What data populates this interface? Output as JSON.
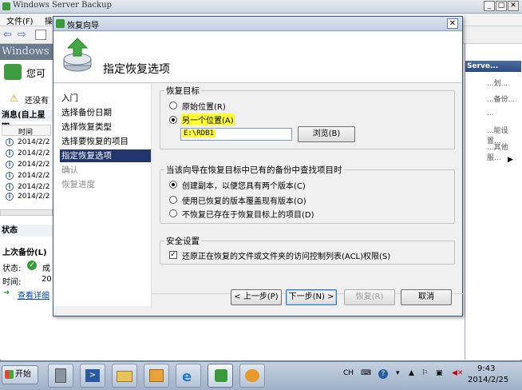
{
  "background_app": {
    "title": "Windows Server Backup",
    "menu": [
      "文件(F)",
      "操"
    ],
    "banner_text": "Windows",
    "banner_subtitle": "您可",
    "warning_text": "还没有",
    "messages_header": "消息(自上星期",
    "column_time": "时间",
    "message_rows": [
      "2014/2/2",
      "2014/2/2",
      "2014/2/2",
      "2014/2/2",
      "2014/2/2",
      "2014/2/2"
    ],
    "status_header": "状态",
    "last_backup_label": "上次备份(L)",
    "status_label": "状态:",
    "status_value": "成",
    "time_label": "时间:",
    "time_value": "20",
    "details_link": "查看详细",
    "right_pane_header": "Serve...",
    "right_pane_items": [
      "...划...",
      "...备份...",
      "...",
      "...能设置...",
      "...其他服..."
    ]
  },
  "wizard": {
    "title": "恢复向导",
    "close_label": "✕",
    "header_title": "指定恢复选项",
    "nav_items": [
      {
        "label": "入门",
        "state": "done"
      },
      {
        "label": "选择备份日期",
        "state": "done"
      },
      {
        "label": "选择恢复类型",
        "state": "done"
      },
      {
        "label": "选择要恢复的项目",
        "state": "done"
      },
      {
        "label": "指定恢复选项",
        "state": "active"
      },
      {
        "label": "确认",
        "state": "pending"
      },
      {
        "label": "恢复进度",
        "state": "pending"
      }
    ],
    "recovery_target": {
      "group_label": "恢复目标",
      "original_location": "原始位置(R)",
      "another_location": "另一个位置(A)",
      "path_value": "E:\\RDB1",
      "browse_button": "浏览(B)",
      "selected": "another_location"
    },
    "existing_items": {
      "group_label": "当该向导在恢复目标中已有的备份中查找项目时",
      "options": [
        {
          "label": "创建副本，以便您具有两个版本(C)",
          "selected": true
        },
        {
          "label": "使用已恢复的版本覆盖现有版本(O)",
          "selected": false
        },
        {
          "label": "不恢复已存在于恢复目标上的项目(D)",
          "selected": false
        }
      ]
    },
    "security": {
      "group_label": "安全设置",
      "acl_checkbox_label": "还原正在恢复的文件或文件夹的访问控制列表(ACL)权限(S)",
      "checked": true
    },
    "buttons": {
      "previous": "< 上一步(P)",
      "next": "下一步(N) >",
      "recover": "恢复(R)",
      "cancel": "取消"
    }
  },
  "taskbar": {
    "start_label": "开始",
    "language": "CH",
    "time": "9:43",
    "date": "2014/2/25"
  }
}
